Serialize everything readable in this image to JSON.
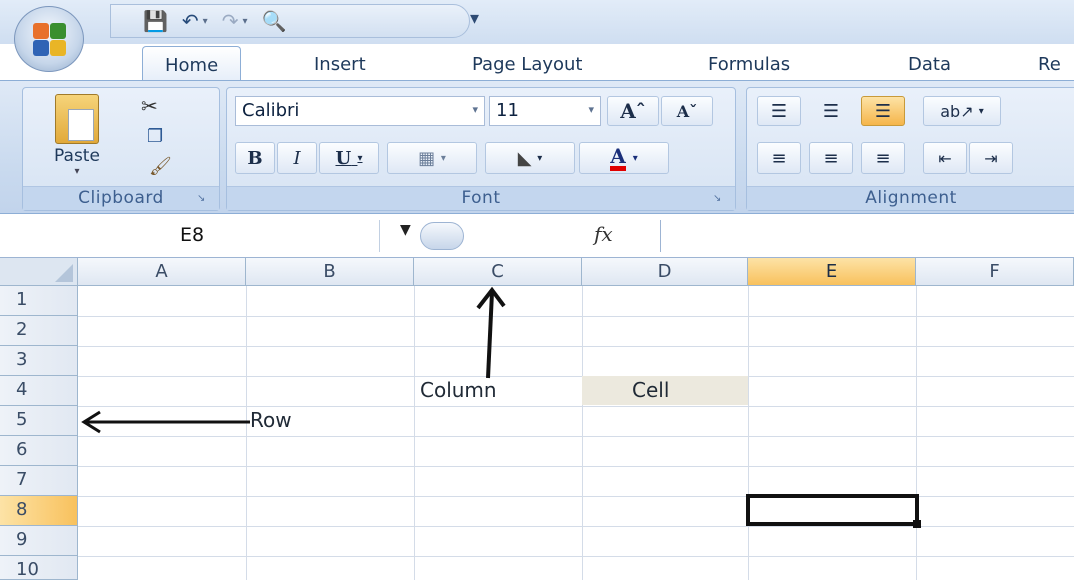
{
  "tabs": [
    "Home",
    "Insert",
    "Page Layout",
    "Formulas",
    "Data",
    "Re"
  ],
  "clipboard": {
    "paste_label": "Paste",
    "group_label": "Clipboard"
  },
  "font": {
    "family": "Calibri",
    "size": "11",
    "group_label": "Font",
    "bold": "B",
    "italic": "I",
    "underline": "U"
  },
  "alignment": {
    "group_label": "Alignment"
  },
  "formula_bar": {
    "name_box": "E8",
    "fx": "fx"
  },
  "columns": [
    "A",
    "B",
    "C",
    "D",
    "E",
    "F"
  ],
  "rows": [
    "1",
    "2",
    "3",
    "4",
    "5",
    "6",
    "7",
    "8",
    "9",
    "10"
  ],
  "selected": {
    "column": "E",
    "row": "8"
  },
  "annotations": {
    "column": "Column",
    "cell": "Cell",
    "row": "Row"
  },
  "colors": {
    "accent_selected": "#f8c15d",
    "ribbon": "#c8d9ee",
    "cell_fill": "#ece9de"
  }
}
